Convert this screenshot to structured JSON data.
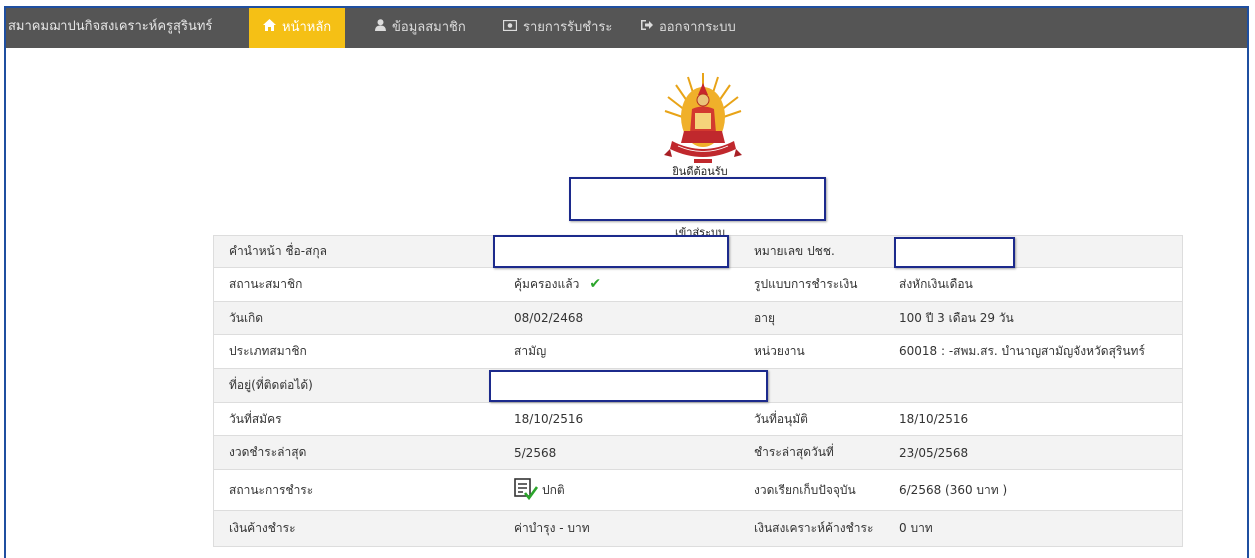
{
  "nav": {
    "brand": "สมาคมฌาปนกิจสงเคราะห์ครูสุรินทร์",
    "items": [
      {
        "icon": "home-icon",
        "label": "หน้าหลัก",
        "active": true
      },
      {
        "icon": "user-icon",
        "label": "ข้อมูลสมาชิก",
        "active": false
      },
      {
        "icon": "money-icon",
        "label": "รายการรับชำระ",
        "active": false
      },
      {
        "icon": "logout-icon",
        "label": "ออกจากระบบ",
        "active": false
      }
    ]
  },
  "header": {
    "welcome": "ยินดีต้อนรับ",
    "login_text": "เข้าสู่ระบบ"
  },
  "rows": [
    {
      "label1": "คำนำหน้า ชื่อ-สกุล",
      "value1": "",
      "label2": "หมายเลข ปชช.",
      "value2": ""
    },
    {
      "label1": "สถานะสมาชิก",
      "value1": "คุ้มครองแล้ว",
      "label2": "รูปแบบการชำระเงิน",
      "value2": "ส่งหักเงินเดือน"
    },
    {
      "label1": "วันเกิด",
      "value1": "08/02/2468",
      "label2": "อายุ",
      "value2": "100 ปี 3 เดือน 29 วัน"
    },
    {
      "label1": "ประเภทสมาชิก",
      "value1": "สามัญ",
      "label2": "หน่วยงาน",
      "value2": "60018 : -สพม.สร. บำนาญสามัญจังหวัดสุรินทร์"
    },
    {
      "label1": "ที่อยู่(ที่ติดต่อได้)",
      "value1": "",
      "label2": "",
      "value2": ""
    },
    {
      "label1": "วันที่สมัคร",
      "value1": "18/10/2516",
      "label2": "วันที่อนุมัติ",
      "value2": "18/10/2516"
    },
    {
      "label1": "งวดชำระล่าสุด",
      "value1": "5/2568",
      "label2": "ชำระล่าสุดวันที่",
      "value2": "23/05/2568"
    },
    {
      "label1": "สถานะการชำระ",
      "value1": "ปกติ",
      "label2": "งวดเรียกเก็บปัจจุบัน",
      "value2": "6/2568 (360 บาท )"
    },
    {
      "label1": "เงินค้างชำระ",
      "value1": "ค่าบำรุง - บาท",
      "label2": "เงินสงเคราะห์ค้างชำระ",
      "value2": "0 บาท"
    }
  ],
  "colors": {
    "nav_bg": "#555555",
    "nav_active": "#f5c015",
    "redaction_border": "#1c2a8c",
    "check": "#2ca52c"
  }
}
